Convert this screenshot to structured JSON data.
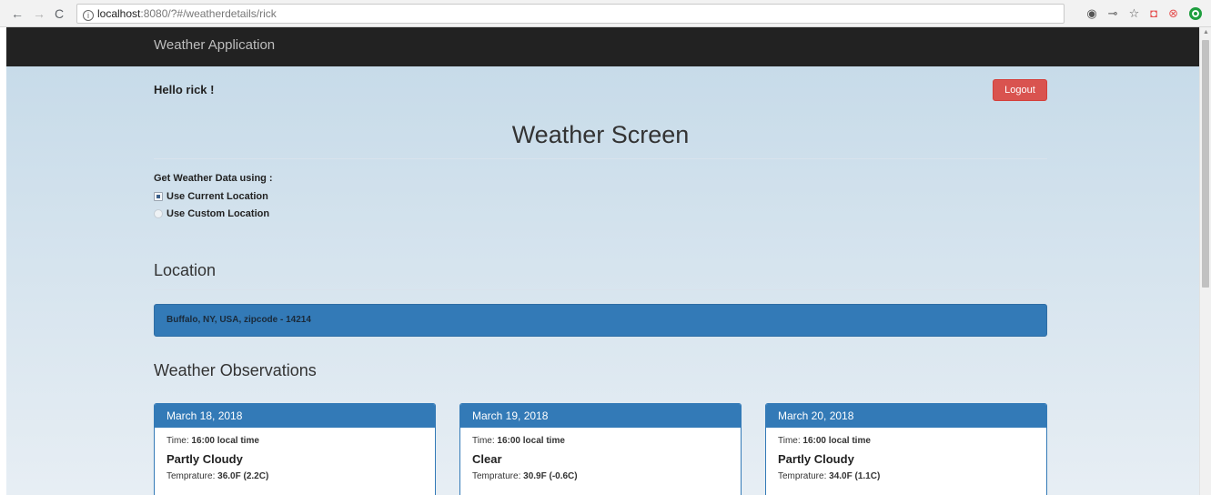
{
  "browser": {
    "url_host": "localhost",
    "url_rest": ":8080/?#/weatherdetails/rick",
    "back_glyph": "←",
    "forward_glyph": "→",
    "reload_glyph": "C",
    "info_glyph": "i",
    "extension_icons": [
      "location-icon",
      "key-icon",
      "star-icon",
      "pocket-icon",
      "extension-icon",
      "opera-icon"
    ]
  },
  "navbar": {
    "brand": "Weather Application"
  },
  "header": {
    "greeting": "Hello rick !",
    "logout_label": "Logout"
  },
  "title": "Weather Screen",
  "source": {
    "label": "Get Weather Data using :",
    "options": [
      {
        "label": "Use Current Location",
        "selected": true
      },
      {
        "label": "Use Custom Location",
        "selected": false
      }
    ]
  },
  "location": {
    "heading": "Location",
    "value": "Buffalo, NY, USA, zipcode - 14214"
  },
  "observations": {
    "heading": "Weather Observations",
    "time_label": "Time: ",
    "temp_label": "Temprature: ",
    "days": [
      {
        "date": "March 18, 2018",
        "time": "16:00 local time",
        "condition": "Partly Cloudy",
        "temperature": "36.0F (2.2C)"
      },
      {
        "date": "March 19, 2018",
        "time": "16:00 local time",
        "condition": "Clear",
        "temperature": "30.9F (-0.6C)"
      },
      {
        "date": "March 20, 2018",
        "time": "16:00 local time",
        "condition": "Partly Cloudy",
        "temperature": "34.0F (1.1C)"
      }
    ]
  },
  "colors": {
    "primary": "#337ab7",
    "danger": "#d9534f",
    "navbar": "#222222"
  }
}
